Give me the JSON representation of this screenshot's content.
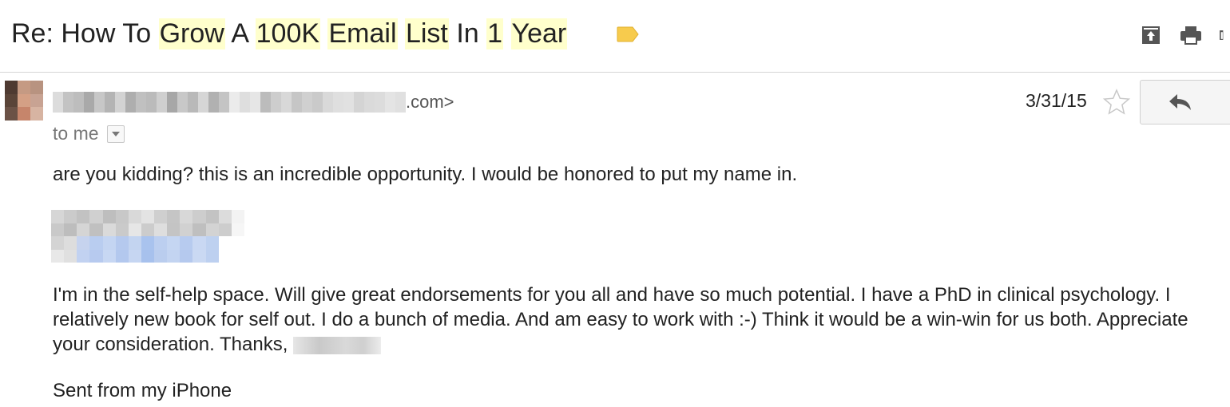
{
  "subject": {
    "segments": [
      {
        "text": "Re: How To ",
        "highlight": false
      },
      {
        "text": "Grow",
        "highlight": true
      },
      {
        "text": " A ",
        "highlight": false
      },
      {
        "text": "100K",
        "highlight": true
      },
      {
        "text": " ",
        "highlight": false
      },
      {
        "text": "Email",
        "highlight": true
      },
      {
        "text": " ",
        "highlight": false
      },
      {
        "text": "List",
        "highlight": true
      },
      {
        "text": " In ",
        "highlight": false
      },
      {
        "text": "1",
        "highlight": true
      },
      {
        "text": " ",
        "highlight": false
      },
      {
        "text": "Year",
        "highlight": true
      }
    ]
  },
  "header_icons": [
    "archive-icon",
    "print-icon",
    "new-window-icon"
  ],
  "message": {
    "sender_suffix": ".com>",
    "recipient": "to me",
    "date": "3/31/15",
    "paragraph1": "are you kidding? this is an incredible opportunity. I would be honored to put my name in.",
    "paragraph2": "I'm in the self-help space. Will give great endorsements for you all and have so much potential.  I have a PhD in clinical psychology. I relatively new book for self out. I do a bunch of media. And am easy to work with :-) Think it would be a win-win for us both. Appreciate your consideration. Thanks,",
    "paragraph3": "Sent from my iPhone"
  },
  "colors": {
    "highlight": "#ffffcc",
    "label_tag": "#f7cb4d",
    "divider": "#d6d6d6"
  }
}
